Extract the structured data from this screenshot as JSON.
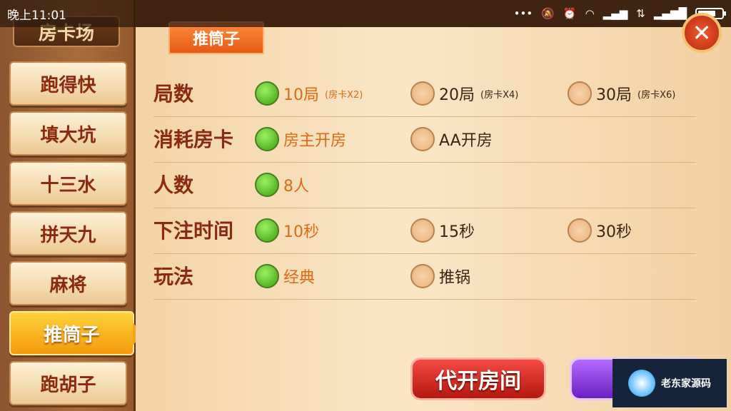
{
  "status_bar": {
    "time": "晚上11:01",
    "icons": [
      "dots-icon",
      "mute-icon",
      "alarm-icon",
      "wifi-icon",
      "signal-icon",
      "signal-icon",
      "4g-icon",
      "battery-icon"
    ]
  },
  "sidebar": {
    "header": "房卡场",
    "items": [
      {
        "label": "跑得快",
        "active": false
      },
      {
        "label": "填大坑",
        "active": false
      },
      {
        "label": "十三水",
        "active": false
      },
      {
        "label": "拼天九",
        "active": false
      },
      {
        "label": "麻将",
        "active": false
      },
      {
        "label": "推筒子",
        "active": true
      },
      {
        "label": "跑胡子",
        "active": false
      }
    ]
  },
  "tab": {
    "label": "推筒子"
  },
  "close": {
    "glyph": "✕"
  },
  "rows": [
    {
      "label": "局数",
      "options": [
        {
          "text": "10局",
          "sub": "(房卡X2)",
          "selected": true
        },
        {
          "text": "20局",
          "sub": "(房卡X4)",
          "selected": false
        },
        {
          "text": "30局",
          "sub": "(房卡X6)",
          "selected": false
        }
      ]
    },
    {
      "label": "消耗房卡",
      "options": [
        {
          "text": "房主开房",
          "sub": "",
          "selected": true
        },
        {
          "text": "AA开房",
          "sub": "",
          "selected": false
        }
      ]
    },
    {
      "label": "人数",
      "options": [
        {
          "text": "8人",
          "sub": "",
          "selected": true
        }
      ]
    },
    {
      "label": "下注时间",
      "options": [
        {
          "text": "10秒",
          "sub": "",
          "selected": true
        },
        {
          "text": "15秒",
          "sub": "",
          "selected": false
        },
        {
          "text": "30秒",
          "sub": "",
          "selected": false
        }
      ]
    },
    {
      "label": "玩法",
      "options": [
        {
          "text": "经典",
          "sub": "",
          "selected": true
        },
        {
          "text": "推锅",
          "sub": "",
          "selected": false
        }
      ]
    }
  ],
  "buttons": {
    "open_for_others": "代开房间"
  },
  "watermark": {
    "text": "老东家源码"
  },
  "colors": {
    "accent": "#e06a12",
    "label": "#8b2a10",
    "selected_radio": "#3a9d11",
    "tab": "#e55a14"
  }
}
